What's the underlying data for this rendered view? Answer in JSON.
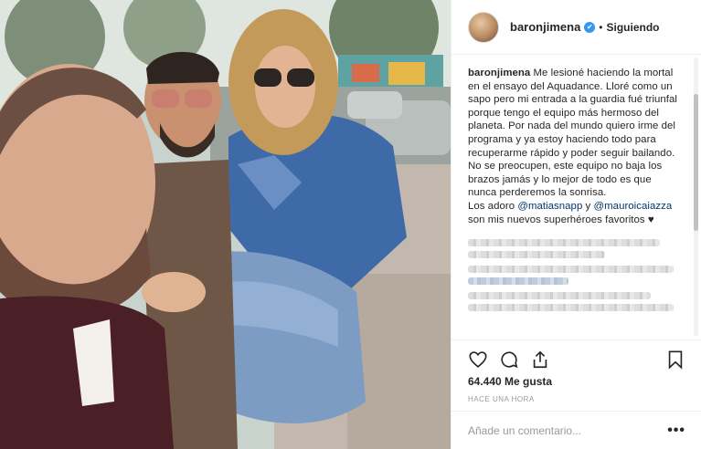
{
  "post": {
    "username": "baronjimena",
    "verified_badge": "✔",
    "separator": "•",
    "follow_status": "Siguiendo",
    "caption": {
      "author": "baronjimena",
      "line1": " Me lesioné haciendo la mortal en el ensayo del Aquadance. Lloré como un sapo pero mi entrada a la guardia fué triunfal porque tengo el equipo más hermoso del planeta. Por nada del mundo quiero irme del programa y ya estoy haciendo todo para recuperarme rápido y poder seguir bailando.",
      "line2": "No se preocupen, este equipo no baja los brazos jamás y lo mejor de todo es que nunca perderemos la sonrisa.",
      "line3_prefix": "Los adoro ",
      "mention1": "@matiasnapp",
      "line3_mid": " y ",
      "mention2": "@mauroicaiazza",
      "line3_suffix": " son mis nuevos superhéroes favoritos ♥"
    },
    "likes": "64.440 Me gusta",
    "timestamp": "HACE UNA HORA",
    "comment_placeholder": "Añade un comentario...",
    "more_label": "•••"
  },
  "icons": {
    "like": "heart-icon",
    "comment": "comment-icon",
    "share": "share-icon",
    "save": "bookmark-icon",
    "more": "more-options-icon"
  },
  "colors": {
    "verified": "#3897f0",
    "mention": "#003569",
    "text": "#262626",
    "muted": "#999999"
  }
}
